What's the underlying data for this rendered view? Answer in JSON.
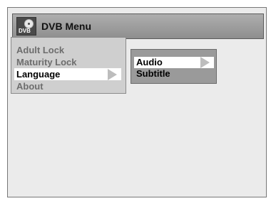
{
  "title": {
    "text": "DVB Menu",
    "icon": "dvb-disc-icon",
    "icon_label": "DVB"
  },
  "menu1": {
    "items": [
      {
        "label": "Adult Lock"
      },
      {
        "label": "Maturity Lock"
      },
      {
        "label": "Language",
        "selected": true
      },
      {
        "label": "About"
      }
    ]
  },
  "menu2": {
    "items": [
      {
        "label": "Audio",
        "selected": true
      },
      {
        "label": "Subtitle"
      }
    ]
  }
}
